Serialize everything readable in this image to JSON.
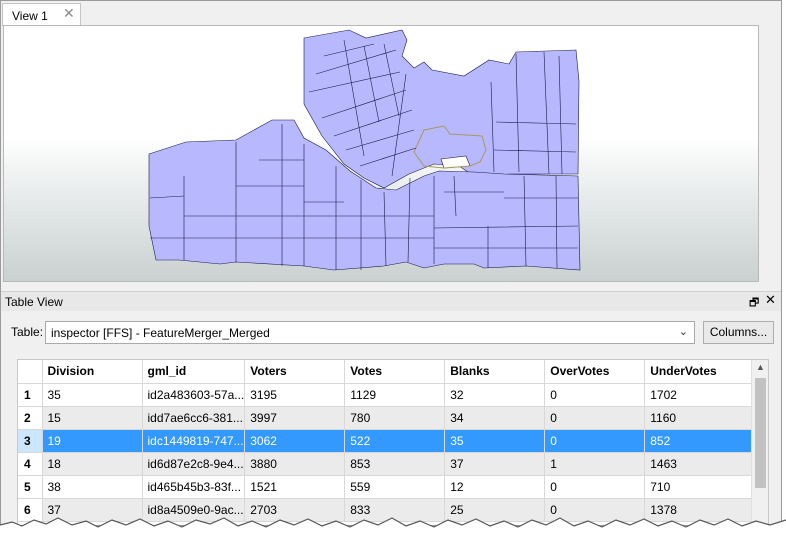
{
  "tabs": [
    {
      "label": "View 1",
      "close": "✕"
    }
  ],
  "table_view": {
    "title": "Table View",
    "float_icon": "restore-icon",
    "close_icon": "close-icon",
    "float_glyph": "🗗",
    "close_glyph": "✕",
    "table_label": "Table:",
    "table_select_value": "inspector [FFS] - FeatureMerger_Merged",
    "columns_button": "Columns...",
    "headers": [
      "Division",
      "gml_id",
      "Voters",
      "Votes",
      "Blanks",
      "OverVotes",
      "UnderVotes"
    ],
    "rows": [
      {
        "num": "1",
        "cells": [
          "35",
          "id2a483603-57a...",
          "3195",
          "1129",
          "32",
          "0",
          "1702"
        ]
      },
      {
        "num": "2",
        "cells": [
          "15",
          "idd7ae6cc6-381...",
          "3997",
          "780",
          "34",
          "0",
          "1160"
        ]
      },
      {
        "num": "3",
        "cells": [
          "19",
          "idc1449819-747...",
          "3062",
          "522",
          "35",
          "0",
          "852"
        ]
      },
      {
        "num": "4",
        "cells": [
          "18",
          "id6d87e2c8-9e4...",
          "3880",
          "853",
          "37",
          "1",
          "1463"
        ]
      },
      {
        "num": "5",
        "cells": [
          "38",
          "id465b45b3-83f...",
          "1521",
          "559",
          "12",
          "0",
          "710"
        ]
      },
      {
        "num": "6",
        "cells": [
          "37",
          "id8a4509e0-9ac...",
          "2703",
          "833",
          "25",
          "0",
          "1378"
        ]
      }
    ],
    "selected_row": 3
  },
  "colors": {
    "map_fill": "#b8b8ff",
    "map_stroke": "#1a1a4a",
    "map_highlight": "#a89860",
    "selection": "#3399ff"
  }
}
